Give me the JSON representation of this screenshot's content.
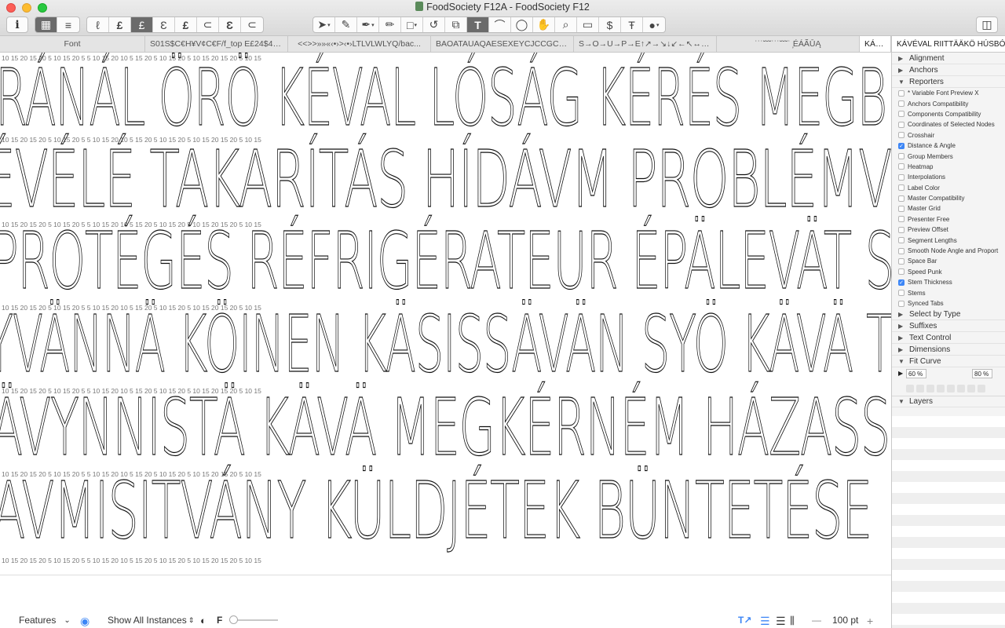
{
  "window": {
    "title": "FoodSociety F12A - FoodSociety F12"
  },
  "toolbar": {
    "info_icon": "i",
    "view_left": [
      "grid-view-icon",
      "list-view-icon"
    ],
    "glyph_buttons": [
      "ℓ",
      "£",
      "£",
      "Ɛ",
      "£",
      "⊂",
      "Ɛ",
      "⊂"
    ],
    "tools": [
      "select-tool-icon",
      "draw-tool-icon",
      "pen-tool-icon",
      "pencil-tool-icon",
      "shape-tool-icon",
      "rotate-tool-icon",
      "scale-tool-icon",
      "text-tool-icon",
      "knife-tool-icon",
      "annotation-tool-icon",
      "hand-tool-icon",
      "zoom-tool-icon",
      "measure-tool-icon",
      "sampling-tool-icon",
      "typesetter-tool-icon",
      "options-tool-icon"
    ],
    "text_tool_label": "T",
    "sidebar_toggle_icon": "sidebar-toggle-icon"
  },
  "tabs": [
    {
      "label": "Font"
    },
    {
      "label": "S01S$C€H¥V¢C€F/f_top E£24$48..."
    },
    {
      "label": "<<>>»»«‹•›>‹•›LTLVLWLYQ/bac..."
    },
    {
      "label": "BAOATAUAQAESEXEYCJCCGCCFC..."
    },
    {
      "label": "S→O→U→P→E↑↗→↘↓↙←↖↔↕H..."
    },
    {
      "label": "˙˙˙˘˘˘˙˙˙˘˘˘˙ ̦ÉÁÃŪĄ"
    },
    {
      "label": "KÁVÉVAL RIITTÄÄKÖ HÚSBÓNDIN..."
    }
  ],
  "canvas": {
    "lines": [
      "RÁNÁL ÖRÖ KÉVAL LÓSÁG KÉRÉS MEGB",
      "ÉVÉLÉ TAKARÍTÁS HÍDÁVM PROBLÉMV",
      "PROTÉGÉS RÉFRIGÉRATEUR ÉPÄLEVÄT S",
      "YVÄNNÄ KÖINEN KÄSISSÄVÄN SYÖ KÄVÄ T",
      "ÄVYNNISTÄ KÄVÄ MEGKÉRNÉM HÁZASS",
      "AVMISITVÁNY KÜLDJÉTEK BÜNTETÉSE"
    ],
    "measure_row": "10  15  20    15  20    5   10  15  20  5   5    10  15  20  10  5   15  20  5   10  15   20   5   10  15   20   15  20  5   10  15"
  },
  "sidebar": {
    "preview_text": "KÁVÉVAL RIITTÄÄKÖ HÚSBÓNDIN...",
    "sections_top": [
      {
        "label": "Alignment",
        "expanded": false
      },
      {
        "label": "Anchors",
        "expanded": false
      },
      {
        "label": "Reporters",
        "expanded": true
      }
    ],
    "reporters": [
      {
        "label": "* Variable Font Preview X",
        "checked": false
      },
      {
        "label": "Anchors Compatibility",
        "checked": false
      },
      {
        "label": "Components Compatibility",
        "checked": false
      },
      {
        "label": "Coordinates of Selected Nodes",
        "checked": false
      },
      {
        "label": "Crosshair",
        "checked": false
      },
      {
        "label": "Distance & Angle",
        "checked": true
      },
      {
        "label": "Group Members",
        "checked": false
      },
      {
        "label": "Heatmap",
        "checked": false
      },
      {
        "label": "Interpolations",
        "checked": false
      },
      {
        "label": "Label Color",
        "checked": false
      },
      {
        "label": "Master Compatibility",
        "checked": false
      },
      {
        "label": "Master Grid",
        "checked": false
      },
      {
        "label": "Presenter Free",
        "checked": false
      },
      {
        "label": "Preview Offset",
        "checked": false
      },
      {
        "label": "Segment Lengths",
        "checked": false
      },
      {
        "label": "Smooth Node Angle and Proport",
        "checked": false
      },
      {
        "label": "Space Bar",
        "checked": false
      },
      {
        "label": "Speed Punk",
        "checked": false
      },
      {
        "label": "Stem Thickness",
        "checked": true
      },
      {
        "label": "Stems",
        "checked": false
      },
      {
        "label": "Synced Tabs",
        "checked": false
      }
    ],
    "sections_mid": [
      {
        "label": "Select by Type",
        "expanded": false
      },
      {
        "label": "Suffixes",
        "expanded": false
      },
      {
        "label": "Text Control",
        "expanded": false
      },
      {
        "label": "Dimensions",
        "expanded": false
      },
      {
        "label": "Fit Curve",
        "expanded": true
      }
    ],
    "fit_curve": {
      "min": "60 %",
      "max": "80 %"
    },
    "layers_label": "Layers"
  },
  "bottombar": {
    "features_label": "Features",
    "instances_label": "Show All Instances",
    "f_label": "F",
    "font_size": "100 pt",
    "minus": "—",
    "plus": "+"
  },
  "colors": {
    "accent": "#3d86f6",
    "active_tool": "#6b6b6b",
    "close": "#fc5f57",
    "minimize": "#fdbc2e",
    "maximize": "#28c840"
  }
}
